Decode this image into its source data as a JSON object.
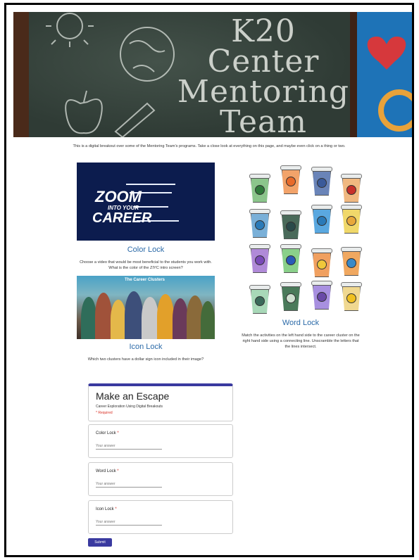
{
  "banner": {
    "title_lines": [
      "K20",
      "Center",
      "Mentoring",
      "Team"
    ]
  },
  "intro_text": "This is a digital breakout over some of the Mentoring Team's programs. Take a close look at everything on this page, and maybe even click on a thing or two.",
  "zoom_image": {
    "line1": "ZOOM",
    "line2": "INTO YOUR",
    "line3": "CAREER"
  },
  "color_lock": {
    "title": "Color Lock",
    "caption": "Choose a video that would be most beneficial to the students you work with.  What is the color of the ZIYC intro screen?"
  },
  "clusters_image": {
    "title": "The Career Clusters"
  },
  "icon_lock": {
    "title": "Icon Lock",
    "caption": "Which two clusters have a dollar sign icon included in their image?"
  },
  "word_lock": {
    "title": "Word Lock",
    "caption": "Match the activities on the left hand side to the career cluster on the right hand side using a connecting line.  Unscramble the letters that the lines intersect."
  },
  "form": {
    "title": "Make an Escape",
    "description": "Career Exploration Using Digital Breakouts",
    "required_note": "* Required",
    "questions": [
      {
        "label": "Color Lock",
        "placeholder": "Your answer"
      },
      {
        "label": "Word Lock",
        "placeholder": "Your answer"
      },
      {
        "label": "Icon Lock",
        "placeholder": "Your answer"
      }
    ],
    "required_star": "*",
    "submit_label": "Submit"
  },
  "colors": {
    "accent": "#3a3aa0",
    "link_blue": "#2b6aa8",
    "required_red": "#d93025"
  }
}
